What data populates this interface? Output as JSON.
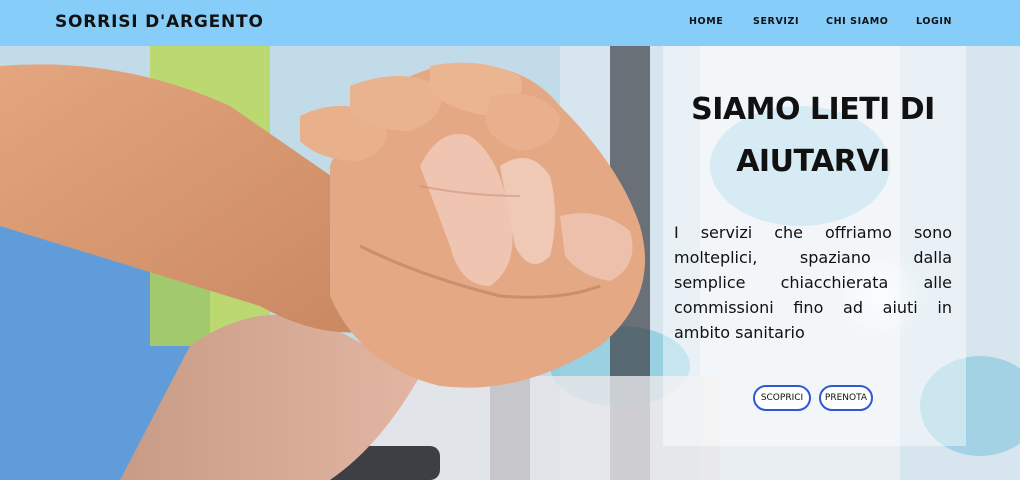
{
  "brand": {
    "name": "SORRISI D'ARGENTO"
  },
  "nav": {
    "items": [
      "HOME",
      "SERVIZI",
      "CHI SIAMO",
      "LOGIN"
    ]
  },
  "hero": {
    "image_subject": "elderly-and-caregiver-holding-hands-photo",
    "title": "SIAMO LIETI DI AIUTARVI",
    "text": "I servizi che offriamo sono molteplici, spaziano dalla semplice chiacchierata alle commissioni fino ad aiuti in ambito sanitario",
    "buttons": [
      "SCOPRICI",
      "PRENOTA"
    ]
  },
  "colors": {
    "navbar": "#86cdfa",
    "button_border": "#2f57d6",
    "text": "#111111"
  }
}
